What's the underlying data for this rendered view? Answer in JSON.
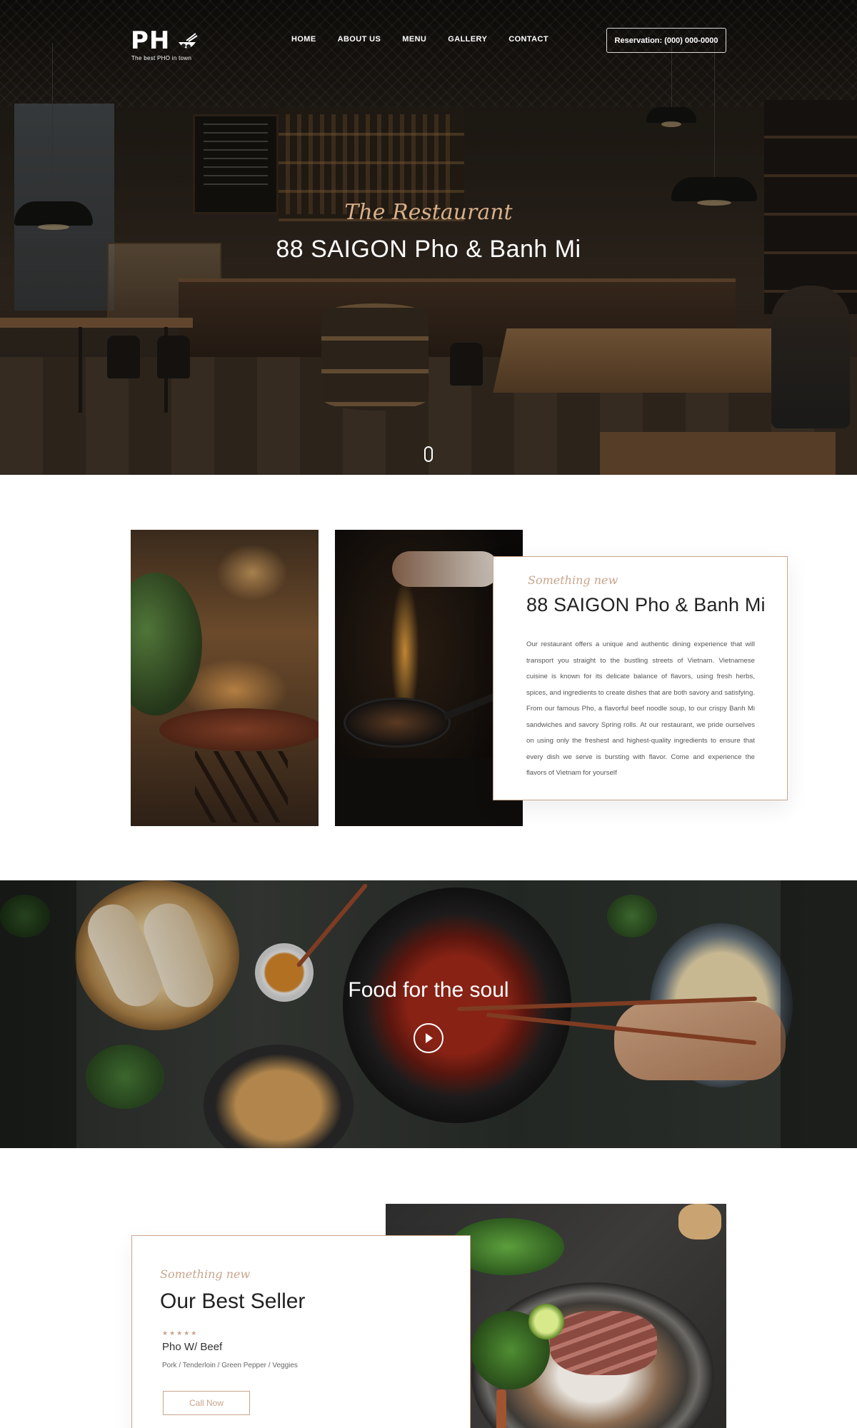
{
  "nav": {
    "logo_text": "PH",
    "logo_tagline": "The best PHO in town",
    "menu": [
      {
        "label": "HOME"
      },
      {
        "label": "ABOUT US"
      },
      {
        "label": "MENU"
      },
      {
        "label": "GALLERY"
      },
      {
        "label": "CONTACT"
      }
    ],
    "reservation": "Reservation: (000) 000-0000"
  },
  "hero": {
    "script": "The Restaurant",
    "title": "88 SAIGON Pho & Banh Mi"
  },
  "about": {
    "script": "Something new",
    "title": "88 SAIGON Pho & Banh Mi",
    "body": "Our restaurant offers a unique and authentic dining experience that will transport you straight to the bustling streets of Vietnam. Vietnamese cuisine is known for its delicate balance of flavors, using fresh herbs, spices, and ingredients to create dishes that are both savory and satisfying. From our famous Pho, a flavorful beef noodle soup, to our crispy Banh Mi sandwiches and savory Spring rolls. At our restaurant, we pride ourselves on using only the freshest and highest-quality ingredients to ensure that every dish we serve is bursting with flavor. Come and experience the flavors of Vietnam for yourself"
  },
  "food_banner": {
    "title": "Food for the soul"
  },
  "best_seller": {
    "script": "Something new",
    "title": "Our Best Seller",
    "rating": 5,
    "stars": "★★★★★",
    "item_name": "Pho W/ Beef",
    "item_desc": "Pork / Tenderloin / Green Pepper / Veggies",
    "cta": "Call Now"
  },
  "colors": {
    "accent": "#c9a48b",
    "hero_script": "#d8b08a",
    "text_dark": "#222222",
    "body_text": "#555555"
  },
  "icons": {
    "play": "play-icon",
    "scroll": "mouse-scroll-icon",
    "logo_bowl": "pho-bowl-icon"
  }
}
